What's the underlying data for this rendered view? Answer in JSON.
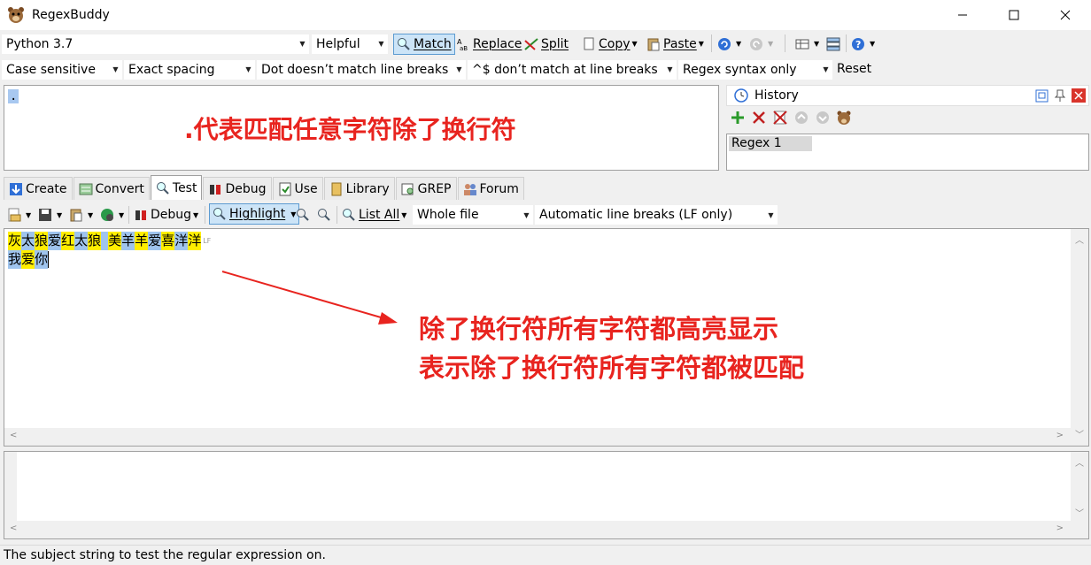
{
  "window": {
    "title": "RegexBuddy"
  },
  "toolbar1": {
    "flavor": "Python 3.7",
    "helpful": "Helpful",
    "match": "Match",
    "replace": "Replace",
    "split": "Split",
    "copy": "Copy",
    "paste": "Paste"
  },
  "toolbar2": {
    "case": "Case sensitive",
    "spacing": "Exact spacing",
    "dot": "Dot doesn’t match line breaks",
    "anchors": "^$ don’t match at line breaks",
    "syntax": "Regex syntax only",
    "reset": "Reset"
  },
  "regex": {
    "text": ".",
    "annotation": ".代表匹配任意字符除了换行符"
  },
  "history": {
    "title": "History",
    "items": [
      "Regex 1"
    ]
  },
  "tabs": [
    "Create",
    "Convert",
    "Test",
    "Debug",
    "Use",
    "Library",
    "GREP",
    "Forum"
  ],
  "test_toolbar": {
    "debug": "Debug",
    "highlight": "Highlight",
    "list_all": "List All",
    "scope": "Whole file",
    "line_breaks": "Automatic line breaks (LF only)"
  },
  "subject": {
    "line1": [
      "灰",
      "太",
      "狼",
      "爱",
      "红",
      "太",
      "狼",
      " ",
      "美",
      "羊",
      "羊",
      "爱",
      "喜",
      "洋",
      "洋"
    ],
    "line2": [
      "我",
      "爱",
      "你"
    ],
    "line1_marks": "LF",
    "annotation1": "除了换行符所有字符都高亮显示",
    "annotation2": "表示除了换行符所有字符都被匹配"
  },
  "status": "The subject string to test the regular expression on.",
  "colors": {
    "highlight_a": "#ffee00",
    "highlight_b": "#9fc4ee",
    "annotation": "#e8241f"
  }
}
